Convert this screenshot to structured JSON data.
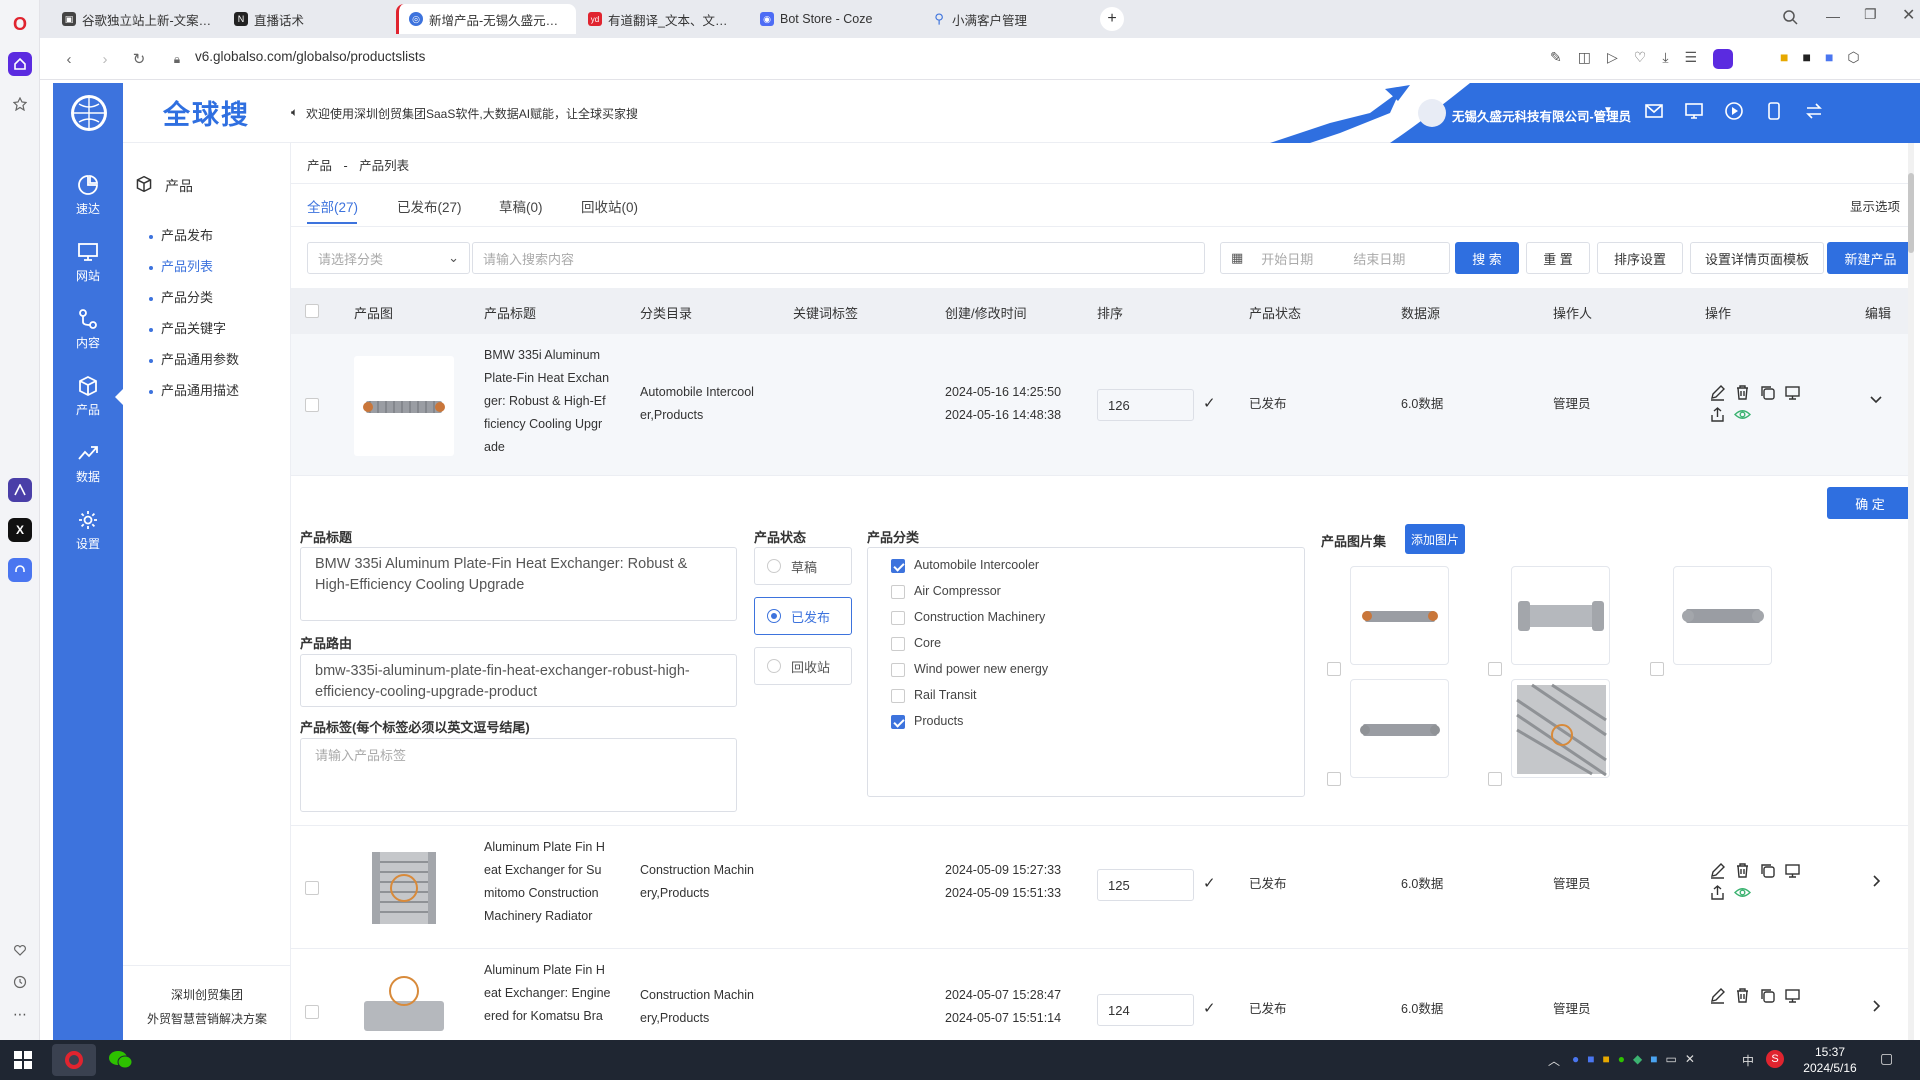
{
  "browser": {
    "tabs": [
      {
        "label": "谷歌独立站上新-文案写作"
      },
      {
        "label": "直播话术"
      },
      {
        "label": "新增产品-无锡久盛元科技"
      },
      {
        "label": "有道翻译_文本、文档、网"
      },
      {
        "label": "Bot Store - Coze"
      },
      {
        "label": "小满客户管理"
      }
    ],
    "url": "v6.globalso.com/globalso/productslists"
  },
  "app": {
    "logo_text": "全球搜",
    "welcome": "欢迎使用深圳创贸集团SaaS软件,大数据AI赋能，让全球买家搜",
    "company": "无锡久盛元科技有限公司-管理员",
    "rail": [
      {
        "label": "速达",
        "icon": "pie-chart-icon"
      },
      {
        "label": "网站",
        "icon": "monitor-icon"
      },
      {
        "label": "内容",
        "icon": "flow-icon"
      },
      {
        "label": "产品",
        "icon": "cube-icon"
      },
      {
        "label": "数据",
        "icon": "trend-icon"
      },
      {
        "label": "设置",
        "icon": "gear-icon"
      }
    ],
    "subnav_title": "产品",
    "subnav": [
      {
        "label": "产品发布"
      },
      {
        "label": "产品列表"
      },
      {
        "label": "产品分类"
      },
      {
        "label": "产品关键字"
      },
      {
        "label": "产品通用参数"
      },
      {
        "label": "产品通用描述"
      }
    ],
    "footer_line1": "深圳创贸集团",
    "footer_line2": "外贸智慧营销解决方案"
  },
  "page": {
    "breadcrumb_root": "产品",
    "breadcrumb_sep": "-",
    "breadcrumb_current": "产品列表",
    "tabs": [
      "全部(27)",
      "已发布(27)",
      "草稿(0)",
      "回收站(0)"
    ],
    "display_options": "显示选项",
    "filters": {
      "category_placeholder": "请选择分类",
      "search_placeholder": "请输入搜索内容",
      "start_date": "开始日期",
      "end_date": "结束日期",
      "search_btn": "搜 索",
      "reset_btn": "重 置",
      "sort_btn": "排序设置",
      "template_btn": "设置详情页面模板",
      "new_btn": "新建产品"
    },
    "columns": [
      "产品图",
      "产品标题",
      "分类目录",
      "关键词标签",
      "创建/修改时间",
      "排序",
      "产品状态",
      "数据源",
      "操作人",
      "操作",
      "编辑"
    ],
    "rows": [
      {
        "title": [
          "BMW 335i Aluminum",
          "Plate-Fin Heat Exchan",
          "ger: Robust & High-Ef",
          "ficiency Cooling Upgr",
          "ade"
        ],
        "category": [
          "Automobile Intercool",
          "er,Products"
        ],
        "created": "2024-05-16 14:25:50",
        "modified": "2024-05-16 14:48:38",
        "sort": "126",
        "status": "已发布",
        "source": "6.0数据",
        "operator": "管理员"
      },
      {
        "title": [
          "Aluminum Plate Fin H",
          "eat Exchanger for Su",
          "mitomo Construction",
          "Machinery Radiator"
        ],
        "category": [
          "Construction Machin",
          "ery,Products"
        ],
        "created": "2024-05-09 15:27:33",
        "modified": "2024-05-09 15:51:33",
        "sort": "125",
        "status": "已发布",
        "source": "6.0数据",
        "operator": "管理员"
      },
      {
        "title": [
          "Aluminum Plate Fin H",
          "eat Exchanger: Engine",
          "ered for Komatsu Bra"
        ],
        "category": [
          "Construction Machin",
          "ery,Products"
        ],
        "created": "2024-05-07 15:28:47",
        "modified": "2024-05-07 15:51:14",
        "sort": "124",
        "status": "已发布",
        "source": "6.0数据",
        "operator": "管理员"
      }
    ],
    "edit": {
      "confirm_btn": "确 定",
      "title_label": "产品标题",
      "title_value": "BMW 335i Aluminum Plate-Fin Heat Exchanger: Robust & High-Efficiency Cooling Upgrade",
      "route_label": "产品路由",
      "route_value": "bmw-335i-aluminum-plate-fin-heat-exchanger-robust-high-efficiency-cooling-upgrade-product",
      "tags_label": "产品标签(每个标签必须以英文逗号结尾)",
      "tags_placeholder": "请输入产品标签",
      "status_label": "产品状态",
      "status_options": [
        {
          "label": "草稿",
          "checked": false
        },
        {
          "label": "已发布",
          "checked": true
        },
        {
          "label": "回收站",
          "checked": false
        }
      ],
      "category_label": "产品分类",
      "categories": [
        {
          "label": "Automobile Intercooler",
          "checked": true
        },
        {
          "label": "Air Compressor",
          "checked": false
        },
        {
          "label": "Construction Machinery",
          "checked": false
        },
        {
          "label": "Core",
          "checked": false
        },
        {
          "label": "Wind power new energy",
          "checked": false
        },
        {
          "label": "Rail Transit",
          "checked": false
        },
        {
          "label": "Products",
          "checked": true
        }
      ],
      "gallery_label": "产品图片集",
      "add_image_btn": "添加图片"
    }
  },
  "taskbar": {
    "time": "15:37",
    "date": "2024/5/16",
    "ime": "中"
  },
  "colors": {
    "primary": "#2f6fe0",
    "rail": "#3d73dd",
    "check": "#3d73dd"
  }
}
